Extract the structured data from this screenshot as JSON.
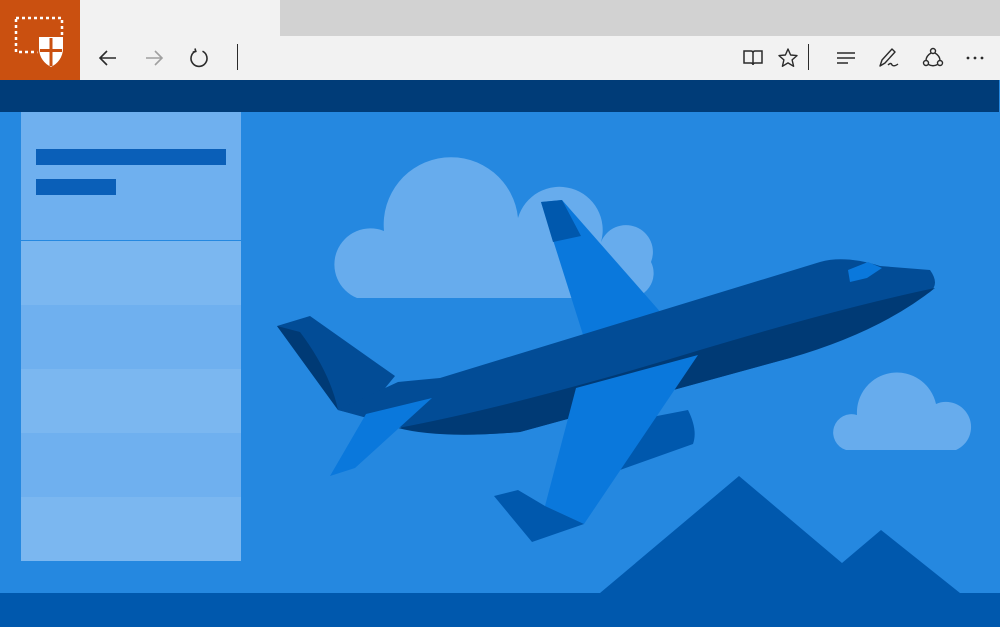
{
  "browser": {
    "badge_icon": "app-shield-icon",
    "toolbar_icons": [
      "back-arrow-icon",
      "forward-arrow-icon",
      "refresh-icon",
      "reading-view-icon",
      "favorite-star-icon",
      "hub-icon",
      "web-note-icon",
      "share-icon",
      "more-icon"
    ],
    "colors": {
      "badge": "#ca5010",
      "chrome": "#f2f2f2",
      "tabstrip": "#d2d2d2"
    }
  },
  "page": {
    "colors": {
      "header": "#003c78",
      "background": "#2588e0",
      "footer": "#0058ad",
      "sidebar": "#6fb0ef"
    },
    "illustration": "airplane-clouds-mountains"
  }
}
